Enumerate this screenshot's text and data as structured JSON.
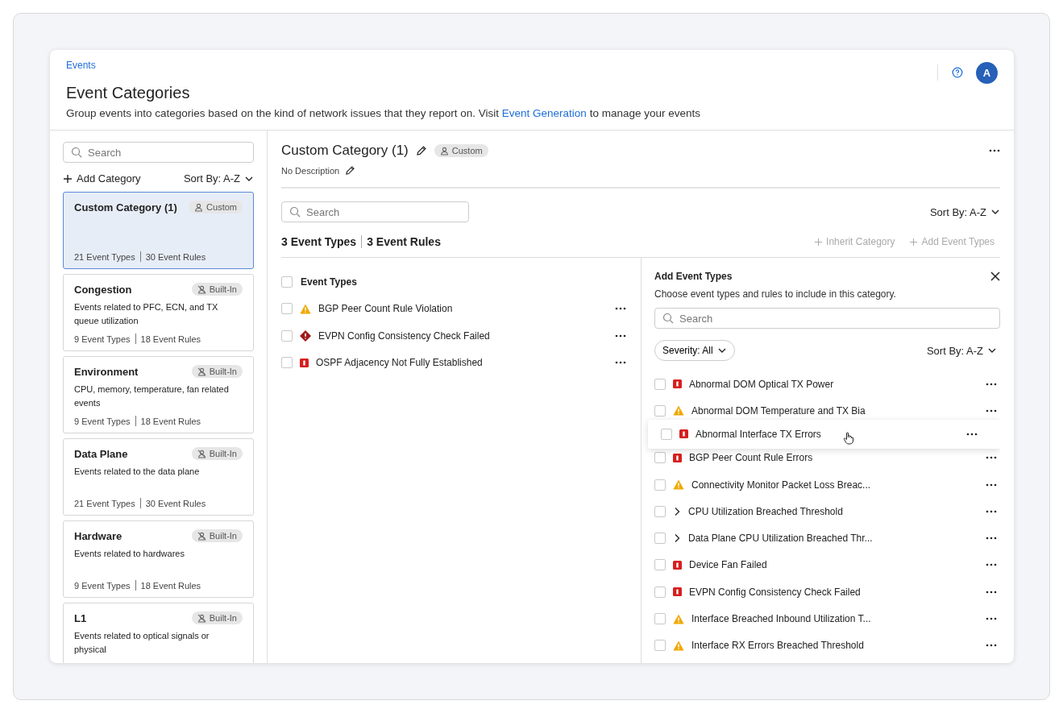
{
  "header": {
    "breadcrumb": "Events",
    "title": "Event Categories",
    "description_before": "Group events into categories based on the kind of network issues that they report on. Visit ",
    "description_link": "Event Generation",
    "description_after": " to manage your events",
    "avatar": "A"
  },
  "sidebar": {
    "search": {
      "placeholder": "Search"
    },
    "add_label": "Add Category",
    "sort_label": "Sort By: A-Z",
    "categories": [
      {
        "name": "Custom Category (1)",
        "badge": "Custom",
        "kind": "custom",
        "types": "21 Event Types",
        "rules": "30 Event Rules",
        "selected": true
      },
      {
        "name": "Congestion",
        "badge": "Built-In",
        "kind": "builtin",
        "description": "Events related to PFC, ECN, and TX queue utilization",
        "types": "9 Event Types",
        "rules": "18 Event Rules",
        "selected": false
      },
      {
        "name": "Environment",
        "badge": "Built-In",
        "kind": "builtin",
        "description": "CPU, memory, temperature, fan related events",
        "types": "9 Event Types",
        "rules": "18 Event Rules",
        "selected": false
      },
      {
        "name": "Data Plane",
        "badge": "Built-In",
        "kind": "builtin",
        "description": "Events related to the data plane",
        "types": "21 Event Types",
        "rules": "30 Event Rules",
        "selected": false
      },
      {
        "name": "Hardware",
        "badge": "Built-In",
        "kind": "builtin",
        "description": "Events related to hardwares",
        "types": "9 Event Types",
        "rules": "18 Event Rules",
        "selected": false
      },
      {
        "name": "L1",
        "badge": "Built-In",
        "kind": "builtin",
        "description": "Events related to optical signals or physical",
        "selected": false
      }
    ]
  },
  "detail": {
    "title": "Custom Category (1)",
    "badge": "Custom",
    "description": "No Description",
    "search": {
      "placeholder": "Search"
    },
    "sort_label": "Sort By: A-Z",
    "types_count": "3 Event Types",
    "rules_count": "3 Event Rules",
    "actions": [
      {
        "label": "Inherit Category",
        "disabled": true
      },
      {
        "label": "Add Event Types",
        "disabled": true
      }
    ],
    "list_header": "Event Types",
    "all_checked": false,
    "event_types": [
      {
        "name": "BGP Peer Count Rule Violation",
        "kind": "warning",
        "checked": false
      },
      {
        "name": "EVPN Config Consistency Check Failed",
        "kind": "critical",
        "checked": false
      },
      {
        "name": "OSPF Adjacency Not Fully Established",
        "kind": "error",
        "checked": false
      }
    ]
  },
  "add_panel": {
    "title": "Add Event Types",
    "description": "Choose event types and rules to include in this category.",
    "search": {
      "placeholder": "Search"
    },
    "severity_filter": "Severity: All",
    "sort_label": "Sort By: A-Z",
    "items": [
      {
        "name": "Abnormal DOM Optical TX Power",
        "kind": "error",
        "dragging": false,
        "checked": false
      },
      {
        "name": "Abnormal DOM Temperature and TX Bia",
        "kind": "warning",
        "dragging": false,
        "checked": false
      },
      {
        "name": "Abnormal Interface TX Errors",
        "kind": "error",
        "dragging": true,
        "checked": false
      },
      {
        "name": "BGP Peer Count Rule Errors",
        "kind": "error",
        "dragging": false,
        "checked": false
      },
      {
        "name": "Connectivity Monitor Packet Loss Breac...",
        "kind": "warning",
        "dragging": false,
        "checked": false
      },
      {
        "name": "CPU Utilization Breached Threshold",
        "kind": "group",
        "dragging": false,
        "checked": false
      },
      {
        "name": "Data Plane CPU Utilization Breached Thr...",
        "kind": "group",
        "dragging": false,
        "checked": false
      },
      {
        "name": "Device Fan Failed",
        "kind": "error",
        "dragging": false,
        "checked": false
      },
      {
        "name": "EVPN Config Consistency Check Failed",
        "kind": "error",
        "dragging": false,
        "checked": false
      },
      {
        "name": "Interface Breached Inbound Utilization T...",
        "kind": "warning",
        "dragging": false,
        "checked": false
      },
      {
        "name": "Interface RX Errors Breached Threshold",
        "kind": "warning",
        "dragging": false,
        "checked": false
      }
    ]
  }
}
